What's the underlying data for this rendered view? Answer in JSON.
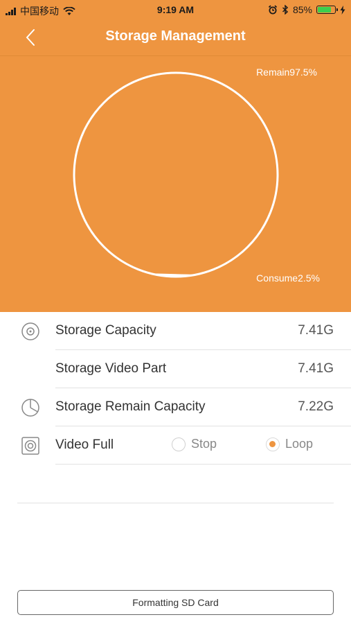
{
  "status_bar": {
    "carrier": "中国移动",
    "time": "9:19 AM",
    "battery_percent_label": "85%",
    "battery_level": 0.85
  },
  "nav": {
    "title": "Storage Management"
  },
  "hero": {
    "remain_label": "Remain97.5%",
    "consume_label": "Consume2.5%",
    "consume_fraction": 0.025
  },
  "rows": {
    "capacity": {
      "label": "Storage Capacity",
      "value": "7.41G"
    },
    "video_part": {
      "label": "Storage Video Part",
      "value": "7.41G"
    },
    "remain": {
      "label": "Storage Remain Capacity",
      "value": "7.22G"
    },
    "video_full": {
      "label": "Video Full",
      "options": [
        "Stop",
        "Loop"
      ],
      "selected": "Loop"
    }
  },
  "format_button": {
    "label": "Formatting SD Card"
  },
  "colors": {
    "accent": "#EE9540",
    "battery": "#3ccf4e"
  }
}
